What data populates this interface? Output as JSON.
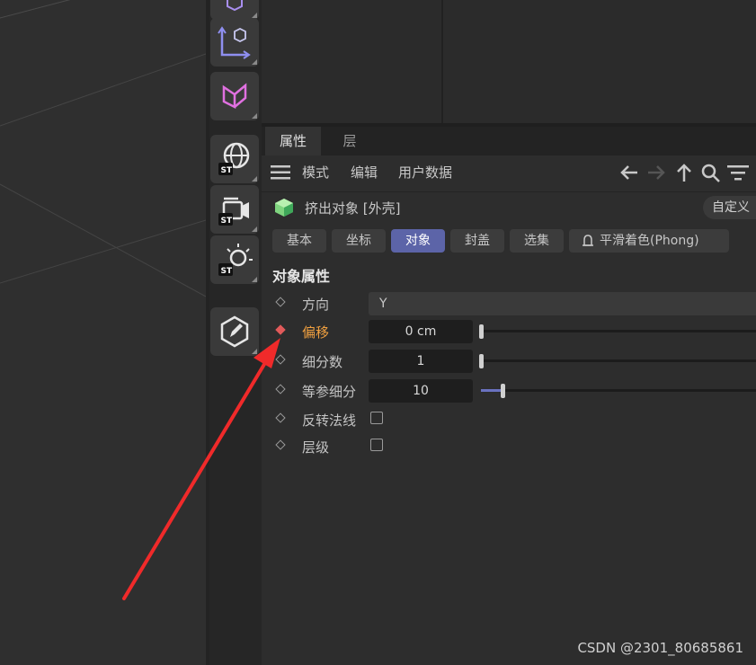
{
  "attributes_panel": {
    "tabs": [
      {
        "label": "属性",
        "active": true
      },
      {
        "label": "层",
        "active": false
      }
    ],
    "menu": [
      "模式",
      "编辑",
      "用户数据"
    ],
    "object_name": "挤出对象 [外壳]",
    "custom_button": "自定义",
    "property_tabs": [
      {
        "label": "基本",
        "active": false
      },
      {
        "label": "坐标",
        "active": false
      },
      {
        "label": "对象",
        "active": true
      },
      {
        "label": "封盖",
        "active": false
      },
      {
        "label": "选集",
        "active": false
      },
      {
        "label": "平滑着色(Phong)",
        "active": false
      }
    ],
    "section_title": "对象属性",
    "properties": [
      {
        "label": "方向",
        "type": "dropdown",
        "value": "Y",
        "keyframed": false
      },
      {
        "label": "偏移",
        "type": "slider",
        "value": "0 cm",
        "fill_fraction": 0.0,
        "keyframed": true
      },
      {
        "label": "细分数",
        "type": "slider",
        "value": "1",
        "fill_fraction": 0.0,
        "keyframed": false
      },
      {
        "label": "等参细分",
        "type": "slider",
        "value": "10",
        "fill_fraction": 0.08,
        "keyframed": false
      },
      {
        "label": "反转法线",
        "type": "checkbox",
        "checked": false,
        "keyframed": false
      },
      {
        "label": "层级",
        "type": "checkbox",
        "checked": false,
        "keyframed": false
      }
    ]
  },
  "toolbar": {
    "icons": [
      "coordinate-axes-icon",
      "bend-deformer-icon",
      "sky-globe-icon",
      "camera-icon",
      "light-icon",
      "edit-tag-icon"
    ]
  },
  "watermark": "CSDN @2301_80685861",
  "colors": {
    "accent": "#5c64a8",
    "highlight_label": "#f0a040",
    "keyframe_active": "#e05a5a",
    "annotation_arrow": "#f02a2a"
  }
}
